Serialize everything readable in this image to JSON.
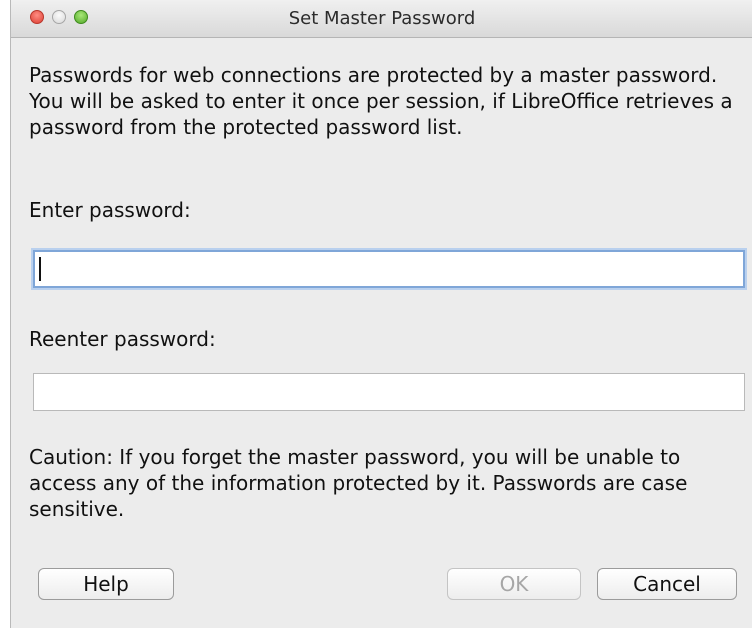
{
  "window": {
    "title": "Set Master Password"
  },
  "dialog": {
    "info": "Passwords for web connections are protected by a master password. You will be asked to enter it once per session, if LibreOffice retrieves a password from the protected password list.",
    "enter_label": "Enter password:",
    "enter_value": "",
    "reenter_label": "Reenter password:",
    "reenter_value": "",
    "caution": "Caution: If you forget the master password, you will be unable to access any of the information protected by it. Passwords are case sensitive."
  },
  "buttons": {
    "help": "Help",
    "ok": "OK",
    "cancel": "Cancel"
  },
  "icons": {
    "close": "close-icon",
    "minimize": "minimize-icon",
    "maximize": "maximize-icon"
  }
}
